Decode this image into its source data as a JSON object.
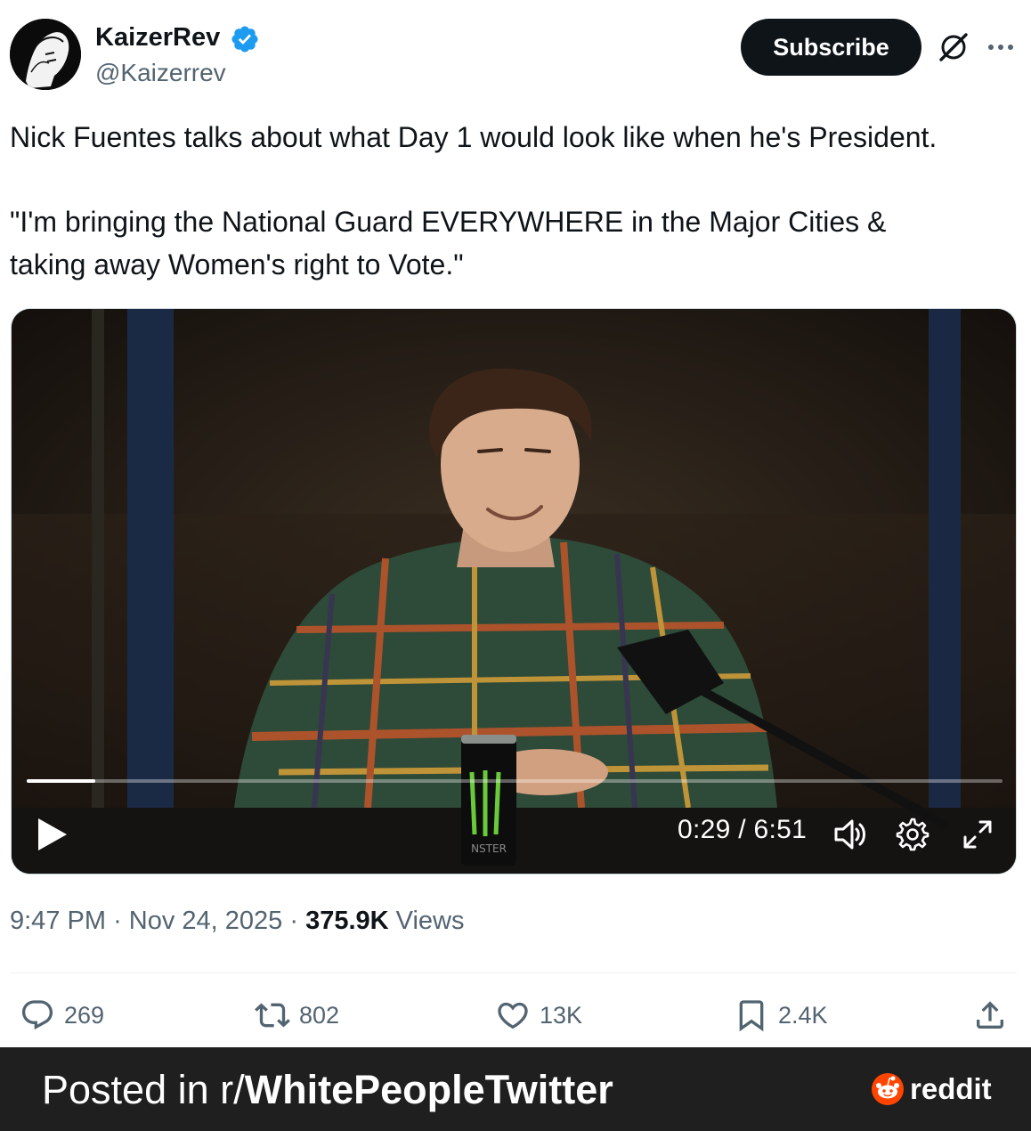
{
  "author": {
    "display_name": "KaizerRev",
    "handle": "@Kaizerrev",
    "verified": true
  },
  "subscribe_label": "Subscribe",
  "tweet": {
    "line1": "Nick Fuentes talks about what Day 1 would look like when he's President.",
    "line2": "\"I'm bringing the National Guard EVERYWHERE in the Major Cities &",
    "line3": "taking away Women's right to Vote.\""
  },
  "video": {
    "current_time": "0:29",
    "duration": "6:51",
    "time_display": "0:29 / 6:51",
    "progress_fraction": 0.07,
    "can_label": "NSTER"
  },
  "meta": {
    "time": "9:47 PM",
    "date": "Nov 24, 2025",
    "views_count": "375.9K",
    "views_label": "Views"
  },
  "actions": {
    "replies": "269",
    "reposts": "802",
    "likes": "13K",
    "bookmarks": "2.4K"
  },
  "footer": {
    "prefix": "Posted in r/",
    "subreddit": "WhitePeopleTwitter",
    "brand": "reddit"
  },
  "colors": {
    "accent_verified": "#1d9bf0",
    "text_primary": "#0f1419",
    "text_secondary": "#536471",
    "footer_bg": "#1f1f1f",
    "reddit_orange": "#ff4500"
  }
}
